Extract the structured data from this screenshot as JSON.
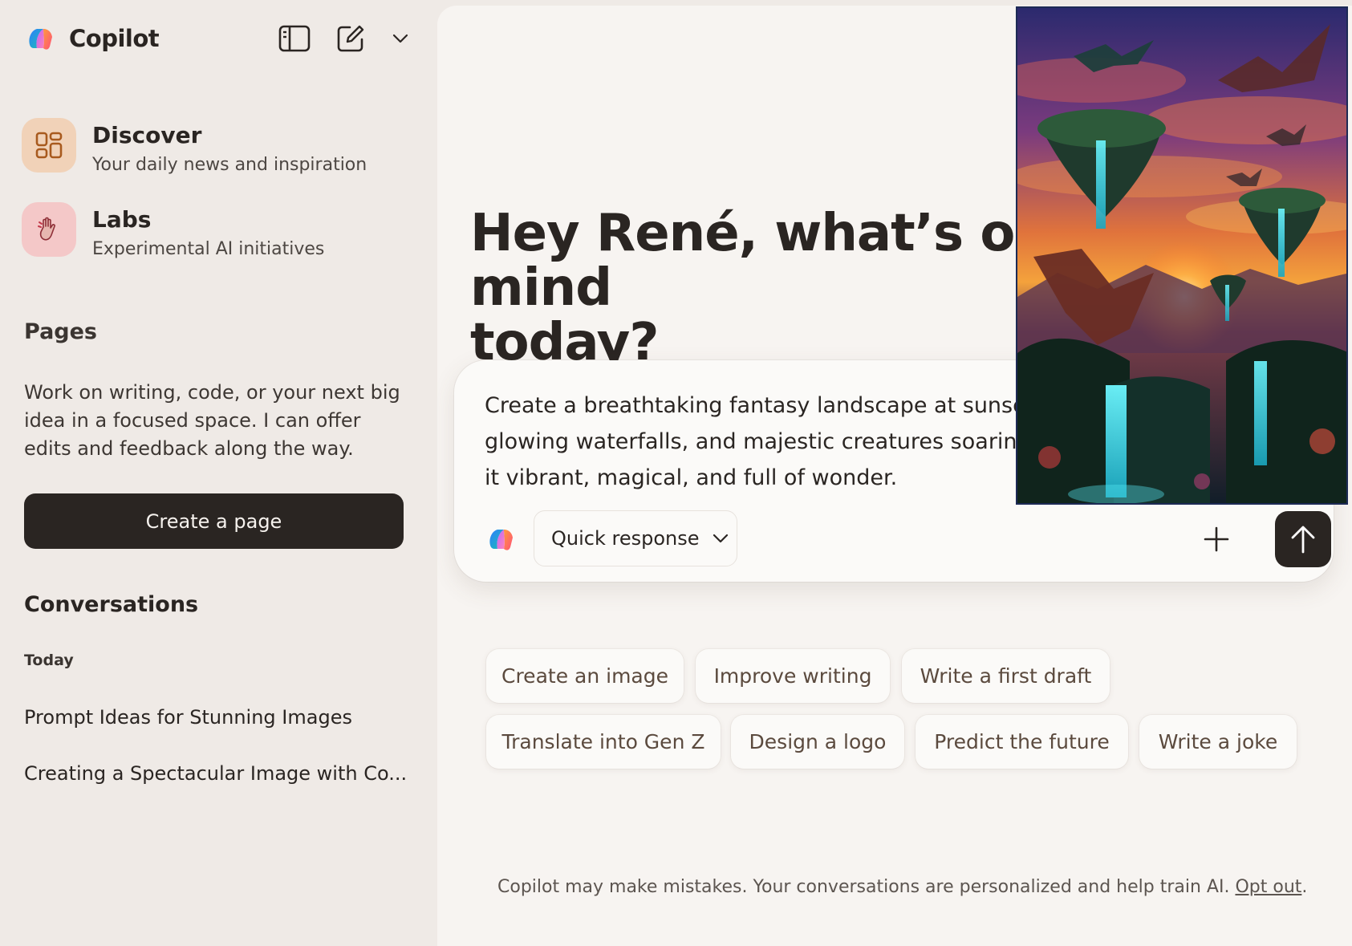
{
  "brand": {
    "name": "Copilot"
  },
  "sidebar": {
    "nav": [
      {
        "title": "Discover",
        "subtitle": "Your daily news and inspiration"
      },
      {
        "title": "Labs",
        "subtitle": "Experimental AI initiatives"
      }
    ],
    "pages": {
      "title": "Pages",
      "description": "Work on writing, code, or your next big idea in a focused space. I can offer edits and feedback along the way.",
      "button_label": "Create a page"
    },
    "conversations": {
      "title": "Conversations",
      "group_label": "Today",
      "items": [
        "Prompt Ideas for Stunning Images",
        "Creating a Spectacular Image with Co..."
      ]
    }
  },
  "main": {
    "greeting_line1": "Hey René, what’s on your mind",
    "greeting_line2": "today?",
    "prompt": "Create a breathtaking fantasy landscape at sunset with floating islands, glowing waterfalls, and majestic creatures soaring through the sky. Make it vibrant, magical, and full of wonder.",
    "mode_label": "Quick response",
    "suggestions": [
      "Create an image",
      "Improve writing",
      "Write a first draft",
      "Translate into Gen Z",
      "Design a logo",
      "Predict the future",
      "Write a joke"
    ],
    "disclaimer": "Copilot may make mistakes. Your conversations are personalized and help train AI.",
    "opt_out": "Opt out",
    "period": "."
  },
  "colors": {
    "sidebar_bg": "#efeae6",
    "main_bg": "#f7f4f1",
    "primary_dark": "#2a2522",
    "chip_text": "#5b4a3e",
    "discover_tile": "#f1d2b8",
    "labs_tile": "#f4c8c8"
  },
  "icons": {
    "brand": "copilot-logo-icon",
    "sidebar_toggle": "sidebar-toggle-icon",
    "new_chat": "compose-icon",
    "menu": "chevron-down-icon",
    "discover": "grid-icon",
    "labs": "hand-icon",
    "add": "plus-icon",
    "send": "arrow-up-icon"
  }
}
